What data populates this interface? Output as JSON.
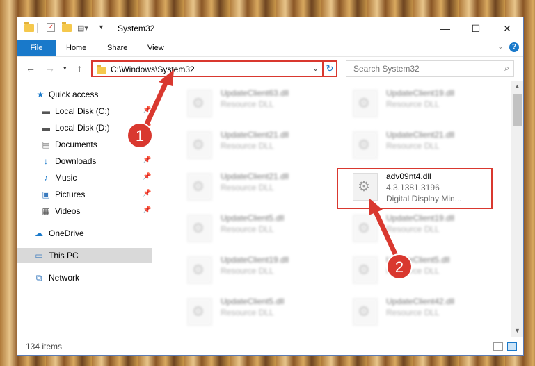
{
  "window": {
    "title": "System32"
  },
  "titlebar": {
    "minimize": "—",
    "maximize": "☐",
    "close": "✕"
  },
  "ribbon": {
    "file": "File",
    "home": "Home",
    "share": "Share",
    "view": "View",
    "help": "?"
  },
  "navbar": {
    "address": "C:\\Windows\\System32",
    "search_placeholder": "Search System32"
  },
  "sidebar": {
    "items": [
      {
        "label": "Quick access"
      },
      {
        "label": "Local Disk (C:)"
      },
      {
        "label": "Local Disk (D:)"
      },
      {
        "label": "Documents"
      },
      {
        "label": "Downloads"
      },
      {
        "label": "Music"
      },
      {
        "label": "Pictures"
      },
      {
        "label": "Videos"
      },
      {
        "label": "OneDrive"
      },
      {
        "label": "This PC"
      },
      {
        "label": "Network"
      }
    ]
  },
  "files": {
    "blurred": [
      {
        "name": "UpdateClient63.dll",
        "type": "Resource DLL"
      },
      {
        "name": "UpdateClient19.dll",
        "type": "Resource DLL"
      },
      {
        "name": "UpdateClient21.dll",
        "type": "Resource DLL"
      },
      {
        "name": "UpdateClient21.dll",
        "type": "Resource DLL"
      },
      {
        "name": "UpdateClient21.dll",
        "type": "Resource DLL"
      },
      {
        "name": "UpdateClient5.dll",
        "type": "Resource DLL"
      },
      {
        "name": "UpdateClient19.dll",
        "type": "Resource DLL"
      },
      {
        "name": "UpdateClient19.dll",
        "type": "Resource DLL"
      },
      {
        "name": "UpdateClient5.dll",
        "type": "Resource DLL"
      },
      {
        "name": "UpdateClient5.dll",
        "type": "Resource DLL"
      },
      {
        "name": "UpdateClient42.dll",
        "type": "Resource DLL"
      }
    ],
    "target": {
      "name": "adv09nt4.dll",
      "version": "4.3.1381.3196",
      "description": "Digital Display Min..."
    }
  },
  "status": {
    "count": "134 items"
  },
  "callouts": {
    "one": "1",
    "two": "2"
  },
  "colors": {
    "accent": "#1979ca",
    "highlight": "#d9382f"
  }
}
